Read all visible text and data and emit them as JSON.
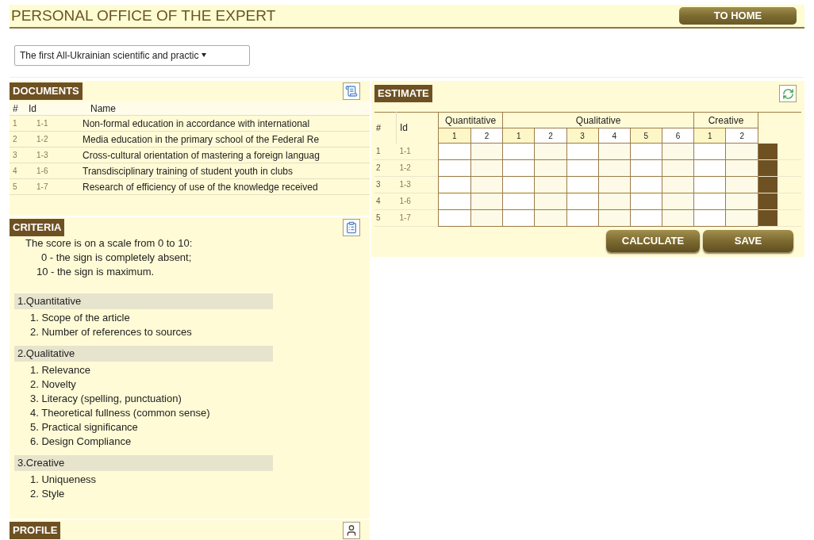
{
  "header": {
    "title": "PERSONAL OFFICE OF THE EXPERT",
    "home_button": "TO HOME"
  },
  "conference_select": {
    "value": "The first All-Ukrainian scientific and practic"
  },
  "documents": {
    "title": "DOCUMENTS",
    "columns": [
      "#",
      "Id",
      "Name"
    ],
    "rows": [
      {
        "number": "1",
        "id": "1-1",
        "name": "Non-formal education in accordance with  international"
      },
      {
        "number": "2",
        "id": "1-2",
        "name": "Media education in the primary school of the Federal Re"
      },
      {
        "number": "3",
        "id": "1-3",
        "name": "Cross-cultural orientation of mastering a foreign languag"
      },
      {
        "number": "4",
        "id": "1-6",
        "name": "Transdisciplinary training of student youth in clubs"
      },
      {
        "number": "5",
        "id": "1-7",
        "name": "Research of efficiency of use of the knowledge received"
      }
    ]
  },
  "criteria": {
    "title": "CRITERIA",
    "intro": [
      "The score is on a scale from 0 to 10:",
      "0 - the sign is completely absent;",
      "10 - the sign is maximum."
    ],
    "groups": [
      {
        "title": "1.Quantitative",
        "items": [
          "1. Scope of the article",
          "2. Number of references to sources"
        ]
      },
      {
        "title": "2.Qualitative",
        "items": [
          "1. Relevance",
          "2. Novelty",
          "3. Literacy (spelling, punctuation)",
          "4. Theoretical fullness (common sense)",
          "5. Practical significance",
          "6. Design Compliance"
        ]
      },
      {
        "title": "3.Creative",
        "items": [
          "1. Uniqueness",
          "2. Style"
        ]
      }
    ]
  },
  "profile": {
    "title": "PROFILE"
  },
  "estimate": {
    "title": "ESTIMATE",
    "number_column": "#",
    "id_column": "Id",
    "groups": [
      {
        "title": "Quantitative",
        "subcolumns": [
          "1",
          "2"
        ]
      },
      {
        "title": "Qualitative",
        "subcolumns": [
          "1",
          "2",
          "3",
          "4",
          "5",
          "6"
        ]
      },
      {
        "title": "Creative",
        "subcolumns": [
          "1",
          "2"
        ]
      }
    ],
    "rows": [
      {
        "number": "1",
        "id": "1-1"
      },
      {
        "number": "2",
        "id": "1-2"
      },
      {
        "number": "3",
        "id": "1-3"
      },
      {
        "number": "4",
        "id": "1-6"
      },
      {
        "number": "5",
        "id": "1-7"
      }
    ],
    "buttons": [
      "CALCULATE",
      "SAVE"
    ]
  }
}
